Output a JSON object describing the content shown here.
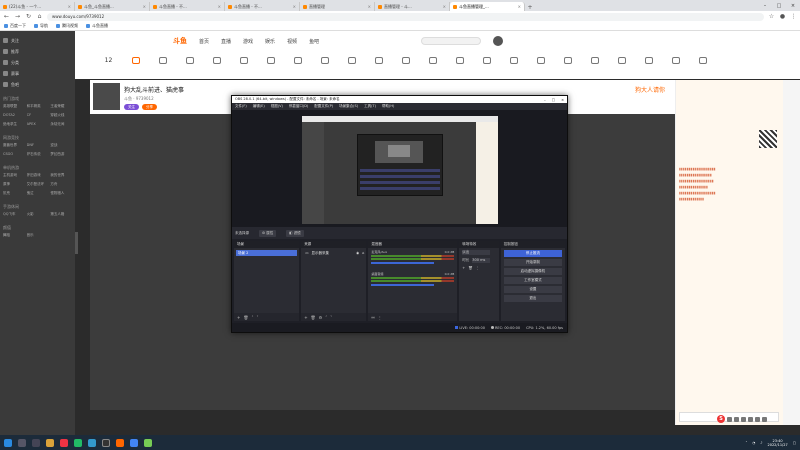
{
  "browser": {
    "tabs": [
      {
        "label": "(22)斗鱼 - 一个..."
      },
      {
        "label": "斗鱼_斗鱼直播..."
      },
      {
        "label": "斗鱼直播 - 不..."
      },
      {
        "label": "斗鱼直播 - 不..."
      },
      {
        "label": "直播管理"
      },
      {
        "label": "直播管理 - 斗..."
      },
      {
        "label": "斗鱼直播管理_..."
      }
    ],
    "url": "www.douyu.com/9739012",
    "bookmarks": [
      "百度一下",
      "导航",
      "腾讯视频",
      "斗鱼直播"
    ]
  },
  "site": {
    "logo": "斗鱼",
    "nav": [
      "首页",
      "直播",
      "游戏",
      "娱乐",
      "视频",
      "鱼吧"
    ],
    "categories": [
      "12",
      "",
      "",
      "",
      "",
      "",
      "",
      "",
      "",
      "",
      "",
      "",
      "",
      "",
      "",
      "",
      "",
      "",
      "",
      "",
      "",
      "",
      ""
    ],
    "sidebar_main": [
      "关注",
      "推荐",
      "分类",
      "赛事",
      "鱼吧"
    ],
    "sidebar_sections": [
      {
        "title": "热门游戏",
        "items": [
          "英雄联盟",
          "和平精英",
          "王者荣耀",
          "DOTA2",
          "CF",
          "穿越火线",
          "绝地求生",
          "APEX",
          "永劫无间"
        ]
      },
      {
        "title": "网游竞技",
        "items": [
          "魔兽世界",
          "DNF",
          "逆战",
          "CSGO",
          "炉石传说",
          "梦幻西游"
        ]
      },
      {
        "title": "单机热游",
        "items": [
          "主机游戏",
          "怀旧游戏",
          "我的世界",
          "原神",
          "艾尔登法环",
          "方舟",
          "饥荒",
          "鬼泣",
          "怪物猎人"
        ]
      },
      {
        "title": "手游休闲",
        "items": [
          "QQ飞车",
          "火影",
          "第五人格"
        ]
      },
      {
        "title": "颜值",
        "items": [
          "舞蹈",
          "音乐"
        ]
      }
    ]
  },
  "streamer": {
    "title": "狗大乱斗前进、猫虎事",
    "meta": "斗鱼 · 9739012",
    "badges": [
      "关注",
      "分享"
    ],
    "right_label": "狗大人请你"
  },
  "obs": {
    "title": "OBS 28.0.1 (64-bit, windows) - 配置文件: 未命名 - 场景: 未命名",
    "menu": [
      "文件(F)",
      "编辑(E)",
      "视图(V)",
      "停靠窗口(D)",
      "配置文件(P)",
      "场景集合(S)",
      "工具(T)",
      "帮助(H)"
    ],
    "source_bar": {
      "label": "未选择源",
      "props": "属性",
      "filters": "滤镜"
    },
    "docks": {
      "scenes": {
        "title": "场景",
        "items": [
          "场景 2"
        ]
      },
      "sources": {
        "title": "来源",
        "items": [
          "显示器采集"
        ]
      },
      "mixer": {
        "title": "混音器",
        "channels": [
          {
            "name": "麦克风/Aux",
            "db": "0.0 dB"
          },
          {
            "name": "桌面音频",
            "db": "0.0 dB"
          }
        ]
      },
      "transitions": {
        "title": "转场特效",
        "type": "淡出",
        "duration_label": "时长",
        "duration": "300 ms"
      },
      "controls": {
        "title": "控制按钮",
        "buttons": [
          "停止推流",
          "开始录制",
          "启动虚拟摄像机",
          "工作室模式",
          "设置",
          "退出"
        ]
      }
    },
    "status": {
      "live": "LIVE: 00:00:00",
      "rec": "REC: 00:00:00",
      "cpu": "CPU: 1.2%, 60.00 fps"
    }
  },
  "taskbar": {
    "time": "23:40",
    "date": "2022/11/27"
  }
}
